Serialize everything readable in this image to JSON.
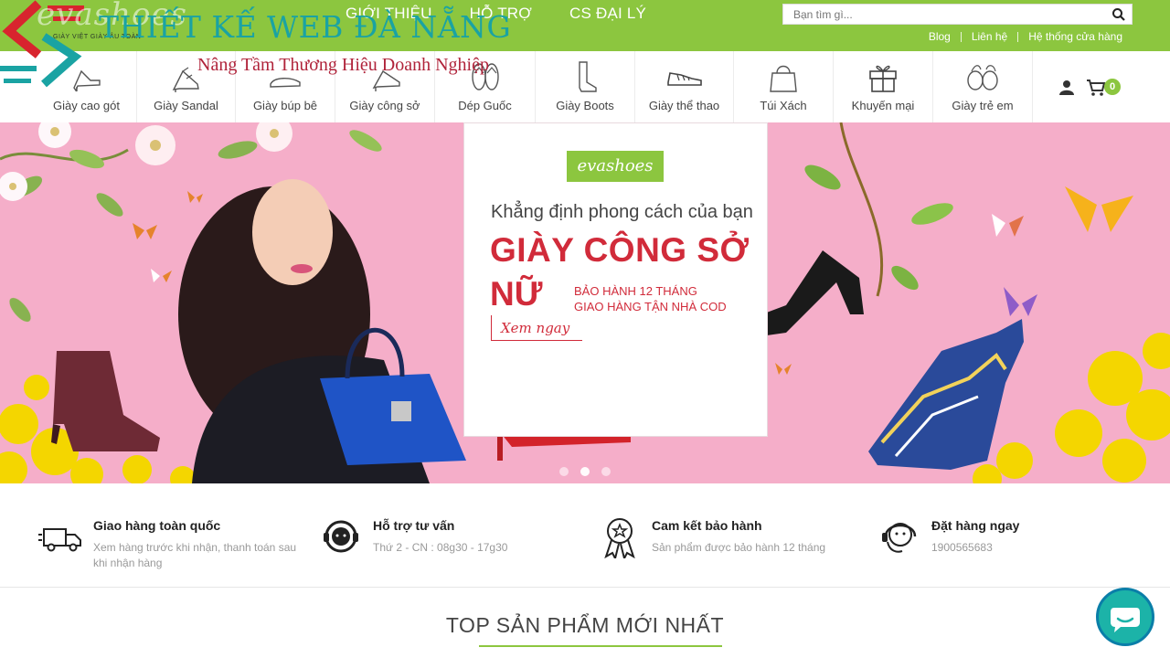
{
  "watermark": {
    "logo_text": "evashoes",
    "logo_sub": "GIÀY VIỆT GIÀY ÂU TOÀN",
    "title": "THIẾT KẾ WEB ĐÀ NẴNG",
    "slogan": "Nâng Tầm Thương Hiệu Doanh Nghiệp"
  },
  "header": {
    "nav": [
      "GIỚI THIỆU",
      "HỖ TRỢ",
      "CS ĐẠI LÝ"
    ],
    "search_placeholder": "Bạn tìm gì...",
    "util_links": [
      "Blog",
      "Liên hệ",
      "Hệ thống cửa hàng"
    ]
  },
  "categories": [
    {
      "label": "Giày cao gót",
      "icon": "high-heel-icon"
    },
    {
      "label": "Giày Sandal",
      "icon": "sandal-icon"
    },
    {
      "label": "Giày búp bê",
      "icon": "flat-shoe-icon"
    },
    {
      "label": "Giày công sở",
      "icon": "office-shoe-icon"
    },
    {
      "label": "Dép Guốc",
      "icon": "flip-flop-icon"
    },
    {
      "label": "Giày Boots",
      "icon": "boot-icon"
    },
    {
      "label": "Giày thể thao",
      "icon": "sneaker-icon"
    },
    {
      "label": "Túi Xách",
      "icon": "handbag-icon"
    },
    {
      "label": "Khuyến mại",
      "icon": "gift-icon"
    },
    {
      "label": "Giày trẻ em",
      "icon": "kids-shoe-icon"
    }
  ],
  "cart": {
    "count": "0"
  },
  "hero": {
    "logo": "evashoes",
    "tagline": "Khẳng định phong cách của bạn",
    "title_line1": "GIÀY CÔNG SỞ",
    "title_line2": "NỮ",
    "warranty_line1": "BẢO HÀNH 12 THÁNG",
    "warranty_line2": "GIAO HÀNG TẬN NHÀ COD",
    "cta": "Xem ngay",
    "slides": 3,
    "active_slide": 2
  },
  "features": [
    {
      "title": "Giao hàng toàn quốc",
      "desc": "Xem hàng trước khi nhận, thanh toán sau khi nhận hàng",
      "icon": "delivery-truck-icon"
    },
    {
      "title": "Hỗ trợ tư vấn",
      "desc": "Thứ 2 - CN : 08g30 - 17g30",
      "icon": "support-headset-icon"
    },
    {
      "title": "Cam kết bảo hành",
      "desc": "Sản phẩm được bảo hành 12 tháng",
      "icon": "warranty-badge-icon"
    },
    {
      "title": "Đặt hàng ngay",
      "desc": "1900565683",
      "icon": "call-center-icon"
    }
  ],
  "section": {
    "title": "TOP SẢN PHẨM MỚI NHẤT"
  },
  "colors": {
    "brand_green": "#8cc63f",
    "promo_red": "#d12b3a",
    "hero_pink": "#f5aec9",
    "chat": "#1cb3a8"
  }
}
